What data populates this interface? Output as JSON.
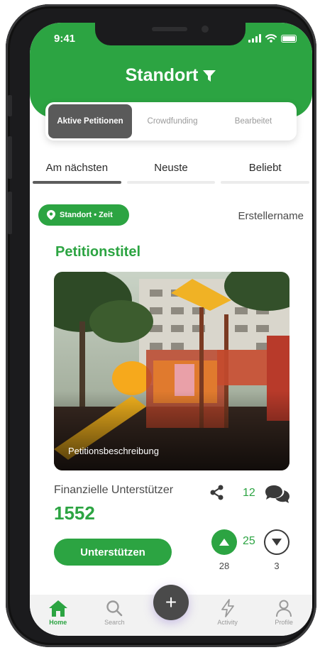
{
  "status_bar": {
    "time": "9:41"
  },
  "header": {
    "title": "Standort"
  },
  "segments": [
    {
      "label": "Aktive Petitionen",
      "active": true
    },
    {
      "label": "Crowdfunding",
      "active": false
    },
    {
      "label": "Bearbeitet",
      "active": false
    }
  ],
  "tabs": [
    {
      "label": "Am nächsten",
      "active": true
    },
    {
      "label": "Neuste",
      "active": false
    },
    {
      "label": "Beliebt",
      "active": false
    }
  ],
  "card": {
    "location_chip": "Standort • Zeit",
    "creator": "Erstellername",
    "title": "Petitionstitel",
    "description": "Petitionsbeschreibung",
    "supporters_label": "Finanzielle Unterstützer",
    "supporters_count": "1552",
    "comments_count": "12",
    "support_button": "Unterstützen",
    "score": "25",
    "upvotes": "28",
    "downvotes": "3"
  },
  "nav": {
    "items": [
      {
        "label": "Home",
        "icon": "home-icon",
        "active": true
      },
      {
        "label": "Search",
        "icon": "search-icon",
        "active": false
      },
      {
        "label": "Activity",
        "icon": "lightning-icon",
        "active": false
      },
      {
        "label": "Profile",
        "icon": "profile-icon",
        "active": false
      }
    ],
    "fab_label": "+"
  },
  "colors": {
    "primary": "#2ca442",
    "dark": "#4a4a4a"
  }
}
